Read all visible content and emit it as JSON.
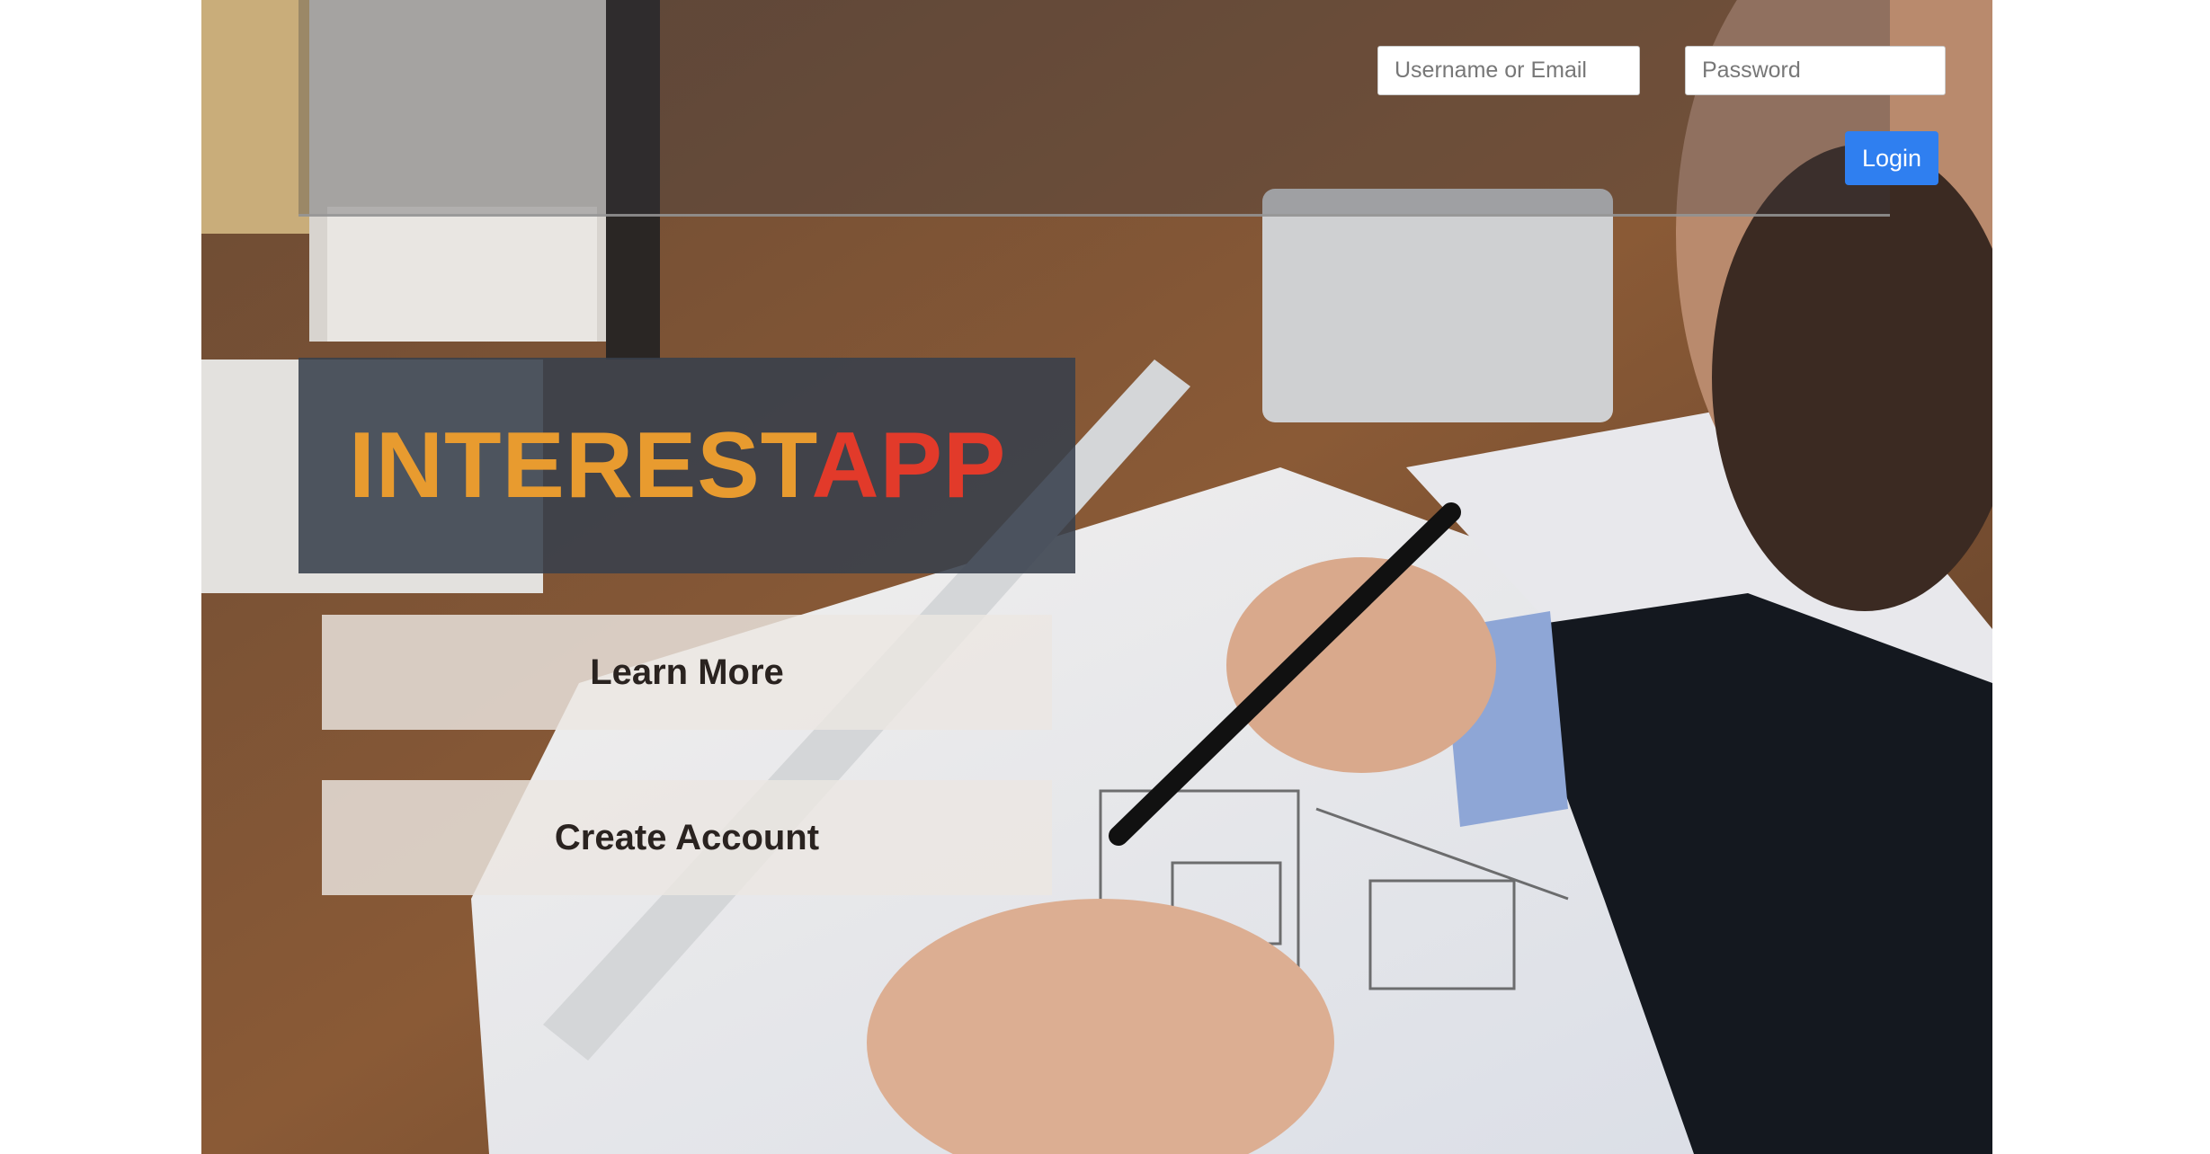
{
  "login": {
    "username_placeholder": "Username or Email",
    "password_placeholder": "Password",
    "button_label": "Login"
  },
  "brand": {
    "part1": "INTEREST",
    "part2": "APP",
    "part1_color": "#e89b2f",
    "part2_color": "#e23a2a"
  },
  "actions": {
    "learn_more_label": "Learn More",
    "create_account_label": "Create Account"
  },
  "colors": {
    "login_button": "#2f7ff0",
    "brand_panel": "#38404c"
  },
  "background": {
    "icon": "architect-drafting-photo-icon"
  }
}
